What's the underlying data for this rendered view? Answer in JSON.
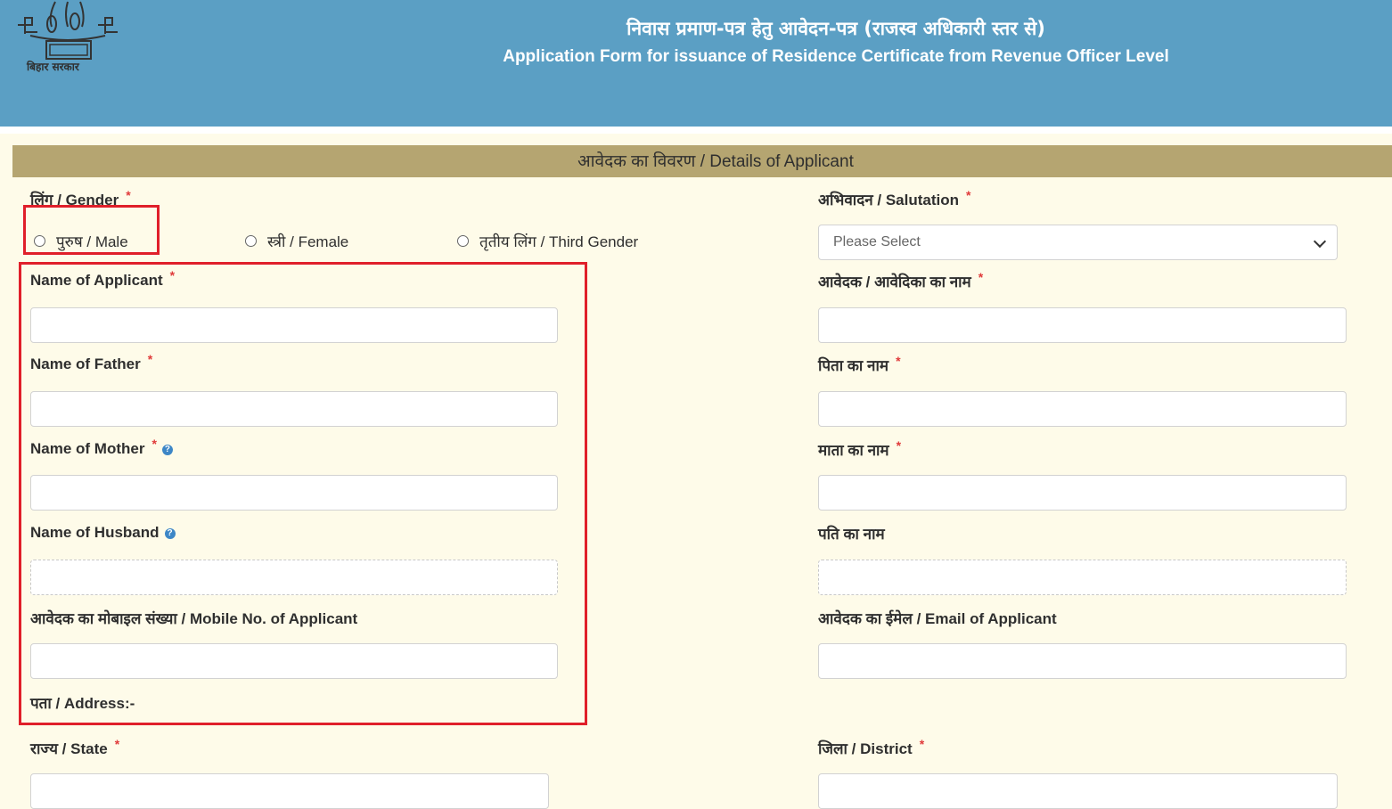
{
  "header": {
    "title_hindi": "निवास प्रमाण-पत्र हेतु आवेदन-पत्र (राजस्व अधिकारी स्तर से)",
    "title_english": "Application Form for issuance of  Residence Certificate from Revenue Officer Level",
    "logo_text": "बिहार सरकार"
  },
  "section": {
    "title": "आवेदक का विवरण / Details of Applicant"
  },
  "gender": {
    "label": "लिंग / Gender",
    "options": [
      "पुरुष / Male",
      "स्त्री / Female",
      "तृतीय लिंग / Third Gender"
    ]
  },
  "salutation": {
    "label": "अभिवादन / Salutation",
    "selected": "Please Select"
  },
  "fields_left": {
    "name_applicant": "Name of Applicant",
    "name_father": "Name of Father",
    "name_mother": "Name of Mother",
    "name_husband": "Name of Husband",
    "mobile": "आवेदक का मोबाइल संख्या / Mobile No. of Applicant",
    "address": "पता / Address:-",
    "state": "राज्य / State"
  },
  "fields_right": {
    "name_applicant_hi": "आवेदक / आवेदिका का नाम",
    "name_father_hi": "पिता का नाम",
    "name_mother_hi": "माता का नाम",
    "name_husband_hi": "पति का नाम",
    "email": "आवेदक का ईमेल / Email of Applicant",
    "district": "जिला / District"
  },
  "required_mark": "*",
  "help_mark": "?",
  "colors": {
    "header_bg": "#5b9fc4",
    "section_bar": "#b5a571",
    "page_bg": "#fefbe9",
    "highlight": "#e01f2a",
    "required": "#e03a3a"
  }
}
